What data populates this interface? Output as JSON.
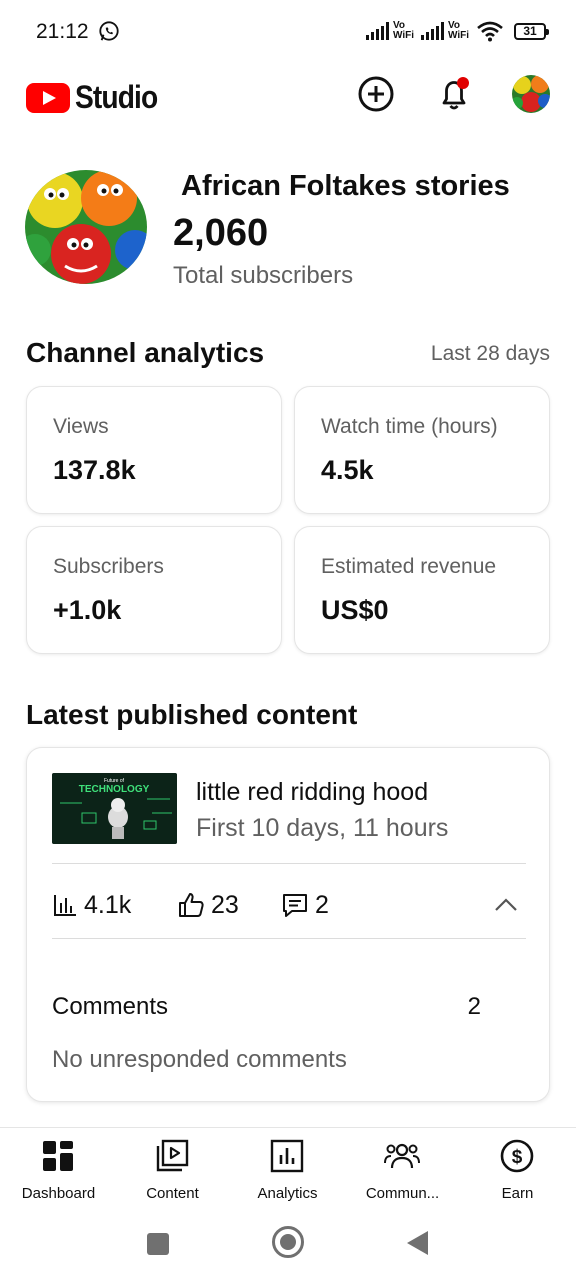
{
  "status_bar": {
    "time": "21:12",
    "network_label_1": "Vo WiFi",
    "network_label_2": "Vo WiFi",
    "battery": "31"
  },
  "header": {
    "app_name": "Studio",
    "brand_color": "#ff0000",
    "icons": [
      "create-icon",
      "notifications-icon",
      "account-avatar"
    ]
  },
  "channel": {
    "name": "African Foltakes stories",
    "subscriber_count": "2,060",
    "subscriber_label": "Total subscribers"
  },
  "analytics": {
    "title": "Channel analytics",
    "range": "Last 28 days",
    "cards": [
      {
        "label": "Views",
        "value": "137.8k"
      },
      {
        "label": "Watch time (hours)",
        "value": "4.5k"
      },
      {
        "label": "Subscribers",
        "value": "+1.0k"
      },
      {
        "label": "Estimated revenue",
        "value": "US$0"
      }
    ]
  },
  "latest": {
    "title": "Latest published content",
    "video": {
      "thumb_caption_1": "Future of",
      "thumb_caption_2": "TECHNOLOGY",
      "title": "little red ridding hood",
      "time": "First 10 days, 11 hours",
      "views": "4.1k",
      "likes": "23",
      "comments": "2"
    },
    "comments_section": {
      "label": "Comments",
      "count": "2",
      "status": "No unresponded comments"
    }
  },
  "bottom_nav": [
    {
      "label": "Dashboard",
      "icon": "dashboard-icon"
    },
    {
      "label": "Content",
      "icon": "content-icon"
    },
    {
      "label": "Analytics",
      "icon": "analytics-icon"
    },
    {
      "label": "Commun...",
      "icon": "community-icon"
    },
    {
      "label": "Earn",
      "icon": "earn-icon"
    }
  ]
}
